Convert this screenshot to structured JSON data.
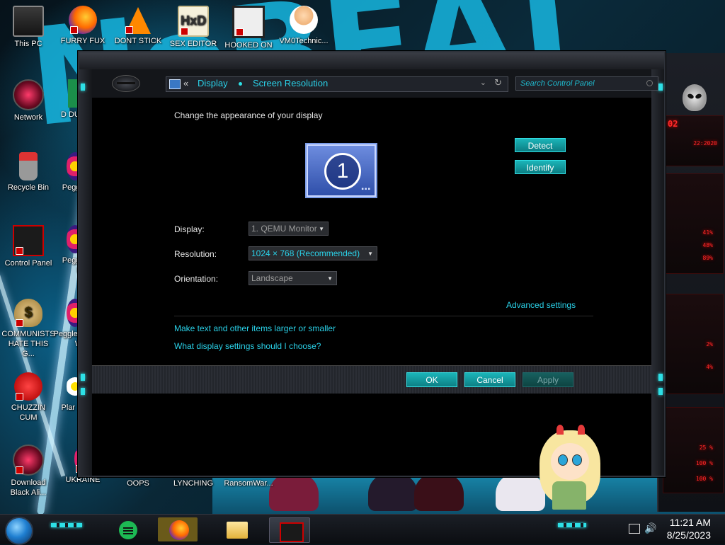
{
  "desktop": {
    "icons_col1": [
      {
        "label": "This PC",
        "icon": "computer-icon"
      },
      {
        "label": "Network",
        "icon": "alien-network-icon"
      },
      {
        "label": "Recycle Bin",
        "icon": "recycle-bin-icon"
      },
      {
        "label": "Control Panel",
        "icon": "control-panel-icon"
      },
      {
        "label": "COMMUNISTS HATE THIS G...",
        "icon": "money-bag-icon"
      },
      {
        "label": "CHUZZIN CUM",
        "icon": "chuzzle-icon"
      },
      {
        "label": "Download Black Ali...",
        "icon": "alien-download-icon"
      }
    ],
    "icons_top": [
      {
        "label": "FURRY FUX",
        "icon": "firefox-icon"
      },
      {
        "label": "DONT STICK",
        "icon": "vlc-cone-icon"
      },
      {
        "label": "SEX EDITOR",
        "icon": "hxd-editor-icon"
      },
      {
        "label": "HOOKED ON",
        "icon": "hooked-on-icon"
      },
      {
        "label": "VM0Technic...",
        "icon": "doctor-icon"
      }
    ],
    "icons_col2_partial": [
      {
        "label": "D DUM",
        "icon": "green-app-icon"
      },
      {
        "label": "Peggle",
        "icon": "peggle-icon"
      },
      {
        "label": "Peggle De",
        "icon": "peggle-icon"
      },
      {
        "label": "Peggle of Wa",
        "icon": "peggle-icon"
      },
      {
        "label": "Plar Zo",
        "icon": "flower-icon"
      }
    ],
    "icons_bottom": [
      {
        "label": "UKRAINE",
        "icon": "app-icon"
      },
      {
        "label": "OOPS",
        "icon": "app-icon"
      },
      {
        "label": "LYNCHING",
        "icon": "app-icon"
      },
      {
        "label": "RansomWar...",
        "icon": "app-icon"
      }
    ]
  },
  "gadget": {
    "readouts": [
      "02",
      "22:2020",
      "41%",
      "48%",
      "89%",
      "2%",
      "4%",
      "25 %",
      "100 %",
      "100 %",
      "100 %"
    ]
  },
  "window": {
    "address": {
      "back": "«",
      "crumb1": "Display",
      "crumb2": "Screen Resolution"
    },
    "search": {
      "placeholder": "Search Control Panel"
    },
    "heading": "Change the appearance of your display",
    "monitor_number": "1",
    "monitor_dots": "▪▪▪",
    "detect_label": "Detect",
    "identify_label": "Identify",
    "display_label": "Display:",
    "display_value": "1. QEMU Monitor",
    "resolution_label": "Resolution:",
    "resolution_value": "1024 × 768 (Recommended)",
    "orientation_label": "Orientation:",
    "orientation_value": "Landscape",
    "advanced_link": "Advanced settings",
    "link1": "Make text and other items larger or smaller",
    "link2": "What display settings should I choose?",
    "ok_label": "OK",
    "cancel_label": "Cancel",
    "apply_label": "Apply",
    "colors": {
      "accent": "#2ad1e8",
      "button": "#1bb5b9"
    }
  },
  "taskbar": {
    "items": [
      "spotify-icon",
      "firefox-icon",
      "file-explorer-icon",
      "control-panel-icon"
    ],
    "active_index": 3,
    "time": "11:21 AM",
    "date": "8/25/2023"
  }
}
